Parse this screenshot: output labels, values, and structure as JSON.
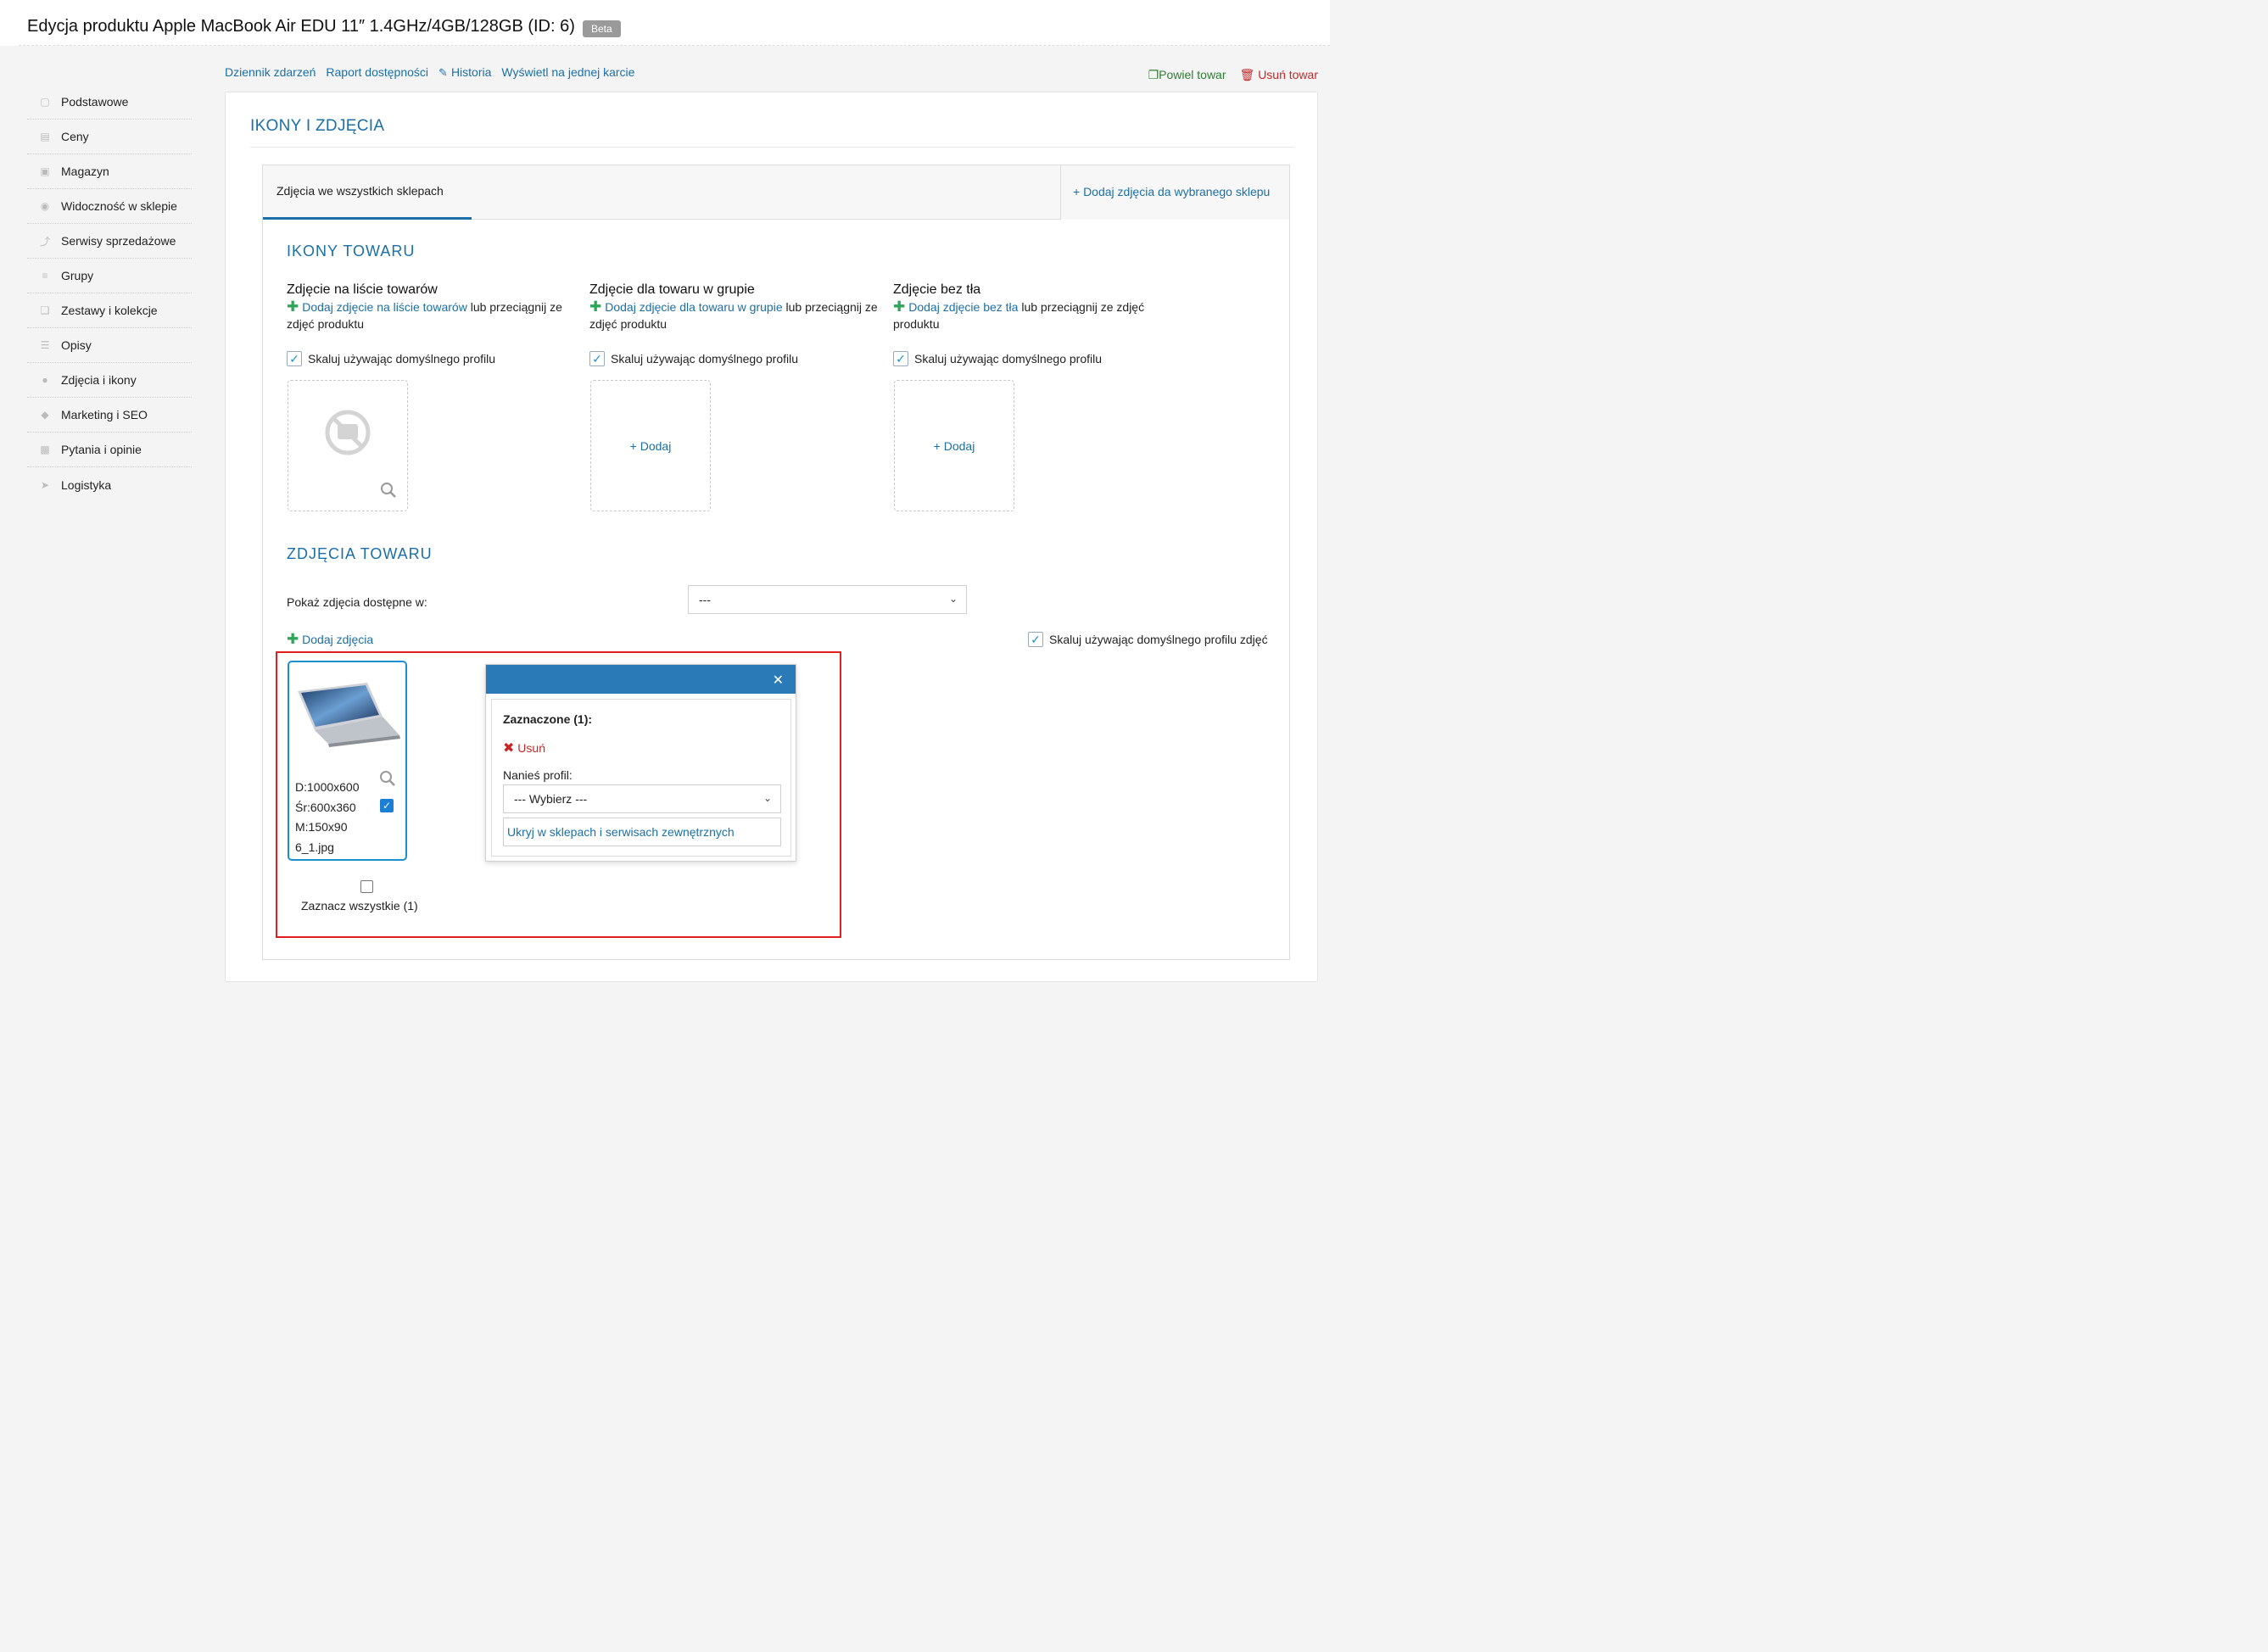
{
  "header": {
    "title": "Edycja produktu Apple MacBook Air EDU 11″ 1.4GHz/4GB/128GB (ID: 6)",
    "badge": "Beta"
  },
  "sidebar": {
    "items": [
      {
        "label": "Podstawowe",
        "icon": "box-icon"
      },
      {
        "label": "Ceny",
        "icon": "money-icon"
      },
      {
        "label": "Magazyn",
        "icon": "warehouse-icon"
      },
      {
        "label": "Widoczność w sklepie",
        "icon": "eye-icon"
      },
      {
        "label": "Serwisy sprzedażowe",
        "icon": "gavel-icon"
      },
      {
        "label": "Grupy",
        "icon": "layers-icon"
      },
      {
        "label": "Zestawy i kolekcje",
        "icon": "collection-icon"
      },
      {
        "label": "Opisy",
        "icon": "lines-icon"
      },
      {
        "label": "Zdjęcia i ikony",
        "icon": "camera-icon"
      },
      {
        "label": "Marketing i SEO",
        "icon": "tag-icon"
      },
      {
        "label": "Pytania i opinie",
        "icon": "comments-icon"
      },
      {
        "label": "Logistyka",
        "icon": "send-icon"
      }
    ]
  },
  "topnav": {
    "events": "Dziennik zdarzeń",
    "availability": "Raport dostępności",
    "history": "Historia",
    "one_card": "Wyświetl na jednej karcie"
  },
  "actions": {
    "duplicate": "Powiel towar",
    "delete": "Usuń towar"
  },
  "card": {
    "title": "IKONY I ZDJĘCIA",
    "tab_active": "Zdjęcia we wszystkich sklepach",
    "tab_add": "+ Dodaj zdjęcia da wybranego sklepu"
  },
  "icons_section": {
    "title": "IKONY TOWARU",
    "columns": [
      {
        "heading": "Zdjęcie na liście towarów",
        "link1": "Dodaj zdjęcie",
        "link2": "na liście towarów",
        "rest": "lub przeciągnij ze zdjęć produktu"
      },
      {
        "heading": "Zdjęcie dla towaru w grupie",
        "link1": "Dodaj zdjęcie",
        "link2": "dla towaru w grupie",
        "rest": "lub przeciągnij ze zdjęć produktu"
      },
      {
        "heading": "Zdjęcie bez tła",
        "link1": "Dodaj zdjęcie",
        "link2": "bez tła",
        "rest": "lub przeciągnij ze zdjęć produktu"
      }
    ],
    "scale_label": "Skaluj używając domyślnego profilu",
    "add_label": "+ Dodaj"
  },
  "photos_section": {
    "title": "ZDJĘCIA TOWARU",
    "show_label": "Pokaż zdjęcia dostępne w:",
    "show_value": "---",
    "add_photos": "Dodaj zdjęcia",
    "scale_label": "Skaluj używając domyślnego profilu zdjęć",
    "photo": {
      "d": "D:1000x600",
      "sr": "Śr:600x360",
      "m": "M:150x90",
      "file": "6_1.jpg"
    },
    "select_all": "Zaznacz wszystkie (1)"
  },
  "popup": {
    "selected": "Zaznaczone (1):",
    "remove": "Usuń",
    "profile_label": "Nanieś profil:",
    "profile_value": "--- Wybierz ---",
    "hide": "Ukryj w sklepach i serwisach zewnętrznych"
  },
  "colors": {
    "accent": "#1b6fa6",
    "green": "#2fa55a",
    "danger": "#c62828",
    "highlight": "#e21f1f",
    "popup_bar": "#2a7ab8"
  }
}
